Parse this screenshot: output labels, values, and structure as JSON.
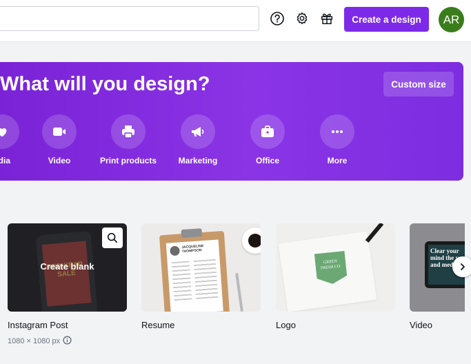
{
  "header": {
    "search": {
      "placeholder": "",
      "value": ""
    },
    "create_label": "Create a design",
    "avatar_initials": "AR",
    "accent_color": "#7d2ae8",
    "avatar_color": "#3a7d1c"
  },
  "hero": {
    "title": "What will you design?",
    "custom_size_label": "Custom size",
    "categories": [
      {
        "label": "edia",
        "icon": "social-media-icon"
      },
      {
        "label": "Video",
        "icon": "video-camera-icon"
      },
      {
        "label": "Print products",
        "icon": "printer-icon"
      },
      {
        "label": "Marketing",
        "icon": "megaphone-icon"
      },
      {
        "label": "Office",
        "icon": "briefcase-icon"
      },
      {
        "label": "More",
        "icon": "more-dots-icon"
      }
    ]
  },
  "templates": [
    {
      "title": "Instagram Post",
      "size": "1080 × 1080 px",
      "overlay_label": "Create blank",
      "thumb_text": "MID-YEAR SALE"
    },
    {
      "title": "Resume",
      "thumb_text": "JACQUELINE THOMPSON"
    },
    {
      "title": "Logo",
      "thumb_text": "GREEN FRESH CO."
    },
    {
      "title": "Video",
      "thumb_text": "Clear your mind the yoga and meditati"
    }
  ]
}
